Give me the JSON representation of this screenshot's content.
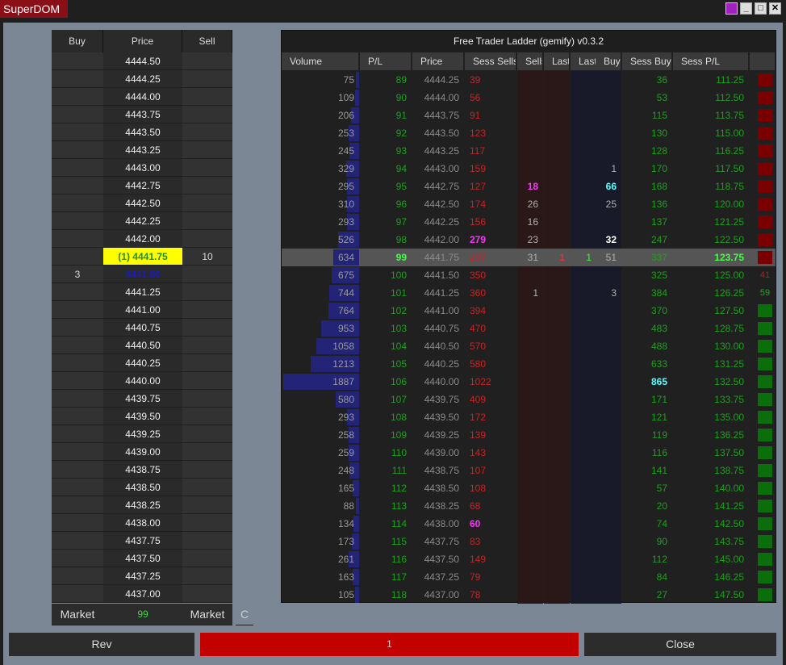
{
  "window": {
    "title": "SuperDOM"
  },
  "dom": {
    "headers": {
      "buy": "Buy",
      "price": "Price",
      "sell": "Sell"
    },
    "rows": [
      {
        "price": "4444.50",
        "buy": "",
        "sell": ""
      },
      {
        "price": "4444.25",
        "buy": "",
        "sell": ""
      },
      {
        "price": "4444.00",
        "buy": "",
        "sell": ""
      },
      {
        "price": "4443.75",
        "buy": "",
        "sell": ""
      },
      {
        "price": "4443.50",
        "buy": "",
        "sell": ""
      },
      {
        "price": "4443.25",
        "buy": "",
        "sell": ""
      },
      {
        "price": "4443.00",
        "buy": "",
        "sell": ""
      },
      {
        "price": "4442.75",
        "buy": "",
        "sell": ""
      },
      {
        "price": "4442.50",
        "buy": "",
        "sell": ""
      },
      {
        "price": "4442.25",
        "buy": "",
        "sell": ""
      },
      {
        "price": "4442.00",
        "buy": "",
        "sell": ""
      },
      {
        "price": "(1) 4441.75",
        "buy": "",
        "sell": "10",
        "style": "position"
      },
      {
        "price": "4441.50",
        "buy": "3",
        "sell": "",
        "style": "bid"
      },
      {
        "price": "4441.25",
        "buy": "",
        "sell": ""
      },
      {
        "price": "4441.00",
        "buy": "",
        "sell": ""
      },
      {
        "price": "4440.75",
        "buy": "",
        "sell": ""
      },
      {
        "price": "4440.50",
        "buy": "",
        "sell": ""
      },
      {
        "price": "4440.25",
        "buy": "",
        "sell": ""
      },
      {
        "price": "4440.00",
        "buy": "",
        "sell": ""
      },
      {
        "price": "4439.75",
        "buy": "",
        "sell": ""
      },
      {
        "price": "4439.50",
        "buy": "",
        "sell": ""
      },
      {
        "price": "4439.25",
        "buy": "",
        "sell": ""
      },
      {
        "price": "4439.00",
        "buy": "",
        "sell": ""
      },
      {
        "price": "4438.75",
        "buy": "",
        "sell": ""
      },
      {
        "price": "4438.50",
        "buy": "",
        "sell": ""
      },
      {
        "price": "4438.25",
        "buy": "",
        "sell": ""
      },
      {
        "price": "4438.00",
        "buy": "",
        "sell": ""
      },
      {
        "price": "4437.75",
        "buy": "",
        "sell": ""
      },
      {
        "price": "4437.50",
        "buy": "",
        "sell": ""
      },
      {
        "price": "4437.25",
        "buy": "",
        "sell": ""
      },
      {
        "price": "4437.00",
        "buy": "",
        "sell": ""
      }
    ],
    "footer": {
      "buy_market": "Market",
      "qty": "99",
      "sell_market": "Market",
      "extra": "C"
    }
  },
  "ladder": {
    "title": "Free Trader Ladder (gemify) v0.3.2",
    "headers": [
      "Volume",
      "P/L",
      "Price",
      "Sess Sells",
      "Sells",
      "Last",
      "Last",
      "Buys",
      "Sess Buys",
      "Sess P/L",
      ""
    ],
    "max_volume": 1887,
    "rows": [
      {
        "volume": "75",
        "pl": "89",
        "price": "4444.25",
        "sess_sells": "39",
        "sells": "",
        "last_s": "",
        "last_b": "",
        "buys": "",
        "sess_buys": "36",
        "sess_pl": "111.25",
        "sig": "red"
      },
      {
        "volume": "109",
        "pl": "90",
        "price": "4444.00",
        "sess_sells": "56",
        "sells": "",
        "last_s": "",
        "last_b": "",
        "buys": "",
        "sess_buys": "53",
        "sess_pl": "112.50",
        "sig": "red"
      },
      {
        "volume": "206",
        "pl": "91",
        "price": "4443.75",
        "sess_sells": "91",
        "sells": "",
        "last_s": "",
        "last_b": "",
        "buys": "",
        "sess_buys": "115",
        "sess_pl": "113.75",
        "sig": "red"
      },
      {
        "volume": "253",
        "pl": "92",
        "price": "4443.50",
        "sess_sells": "123",
        "sells": "",
        "last_s": "",
        "last_b": "",
        "buys": "",
        "sess_buys": "130",
        "sess_pl": "115.00",
        "sig": "red"
      },
      {
        "volume": "245",
        "pl": "93",
        "price": "4443.25",
        "sess_sells": "117",
        "sells": "",
        "last_s": "",
        "last_b": "",
        "buys": "",
        "sess_buys": "128",
        "sess_pl": "116.25",
        "sig": "red"
      },
      {
        "volume": "329",
        "pl": "94",
        "price": "4443.00",
        "sess_sells": "159",
        "sells": "",
        "last_s": "",
        "last_b": "",
        "buys": "1",
        "sess_buys": "170",
        "sess_pl": "117.50",
        "sig": "red"
      },
      {
        "volume": "295",
        "pl": "95",
        "price": "4442.75",
        "sess_sells": "127",
        "sells": "18",
        "sells_style": "magenta",
        "last_s": "",
        "last_b": "",
        "buys": "66",
        "buys_style": "cyan",
        "sess_buys": "168",
        "sess_pl": "118.75",
        "sig": "red"
      },
      {
        "volume": "310",
        "pl": "96",
        "price": "4442.50",
        "sess_sells": "174",
        "sells": "26",
        "last_s": "",
        "last_b": "",
        "buys": "25",
        "sess_buys": "136",
        "sess_pl": "120.00",
        "sig": "red"
      },
      {
        "volume": "293",
        "pl": "97",
        "price": "4442.25",
        "sess_sells": "156",
        "sells": "16",
        "last_s": "",
        "last_b": "",
        "buys": "",
        "sess_buys": "137",
        "sess_pl": "121.25",
        "sig": "red"
      },
      {
        "volume": "526",
        "pl": "98",
        "price": "4442.00",
        "sess_sells": "279",
        "sess_sells_style": "magenta",
        "sells": "23",
        "last_s": "",
        "last_b": "",
        "buys": "32",
        "buys_style": "white",
        "sess_buys": "247",
        "sess_pl": "122.50",
        "sig": "red"
      },
      {
        "volume": "634",
        "pl": "99",
        "price": "4441.75",
        "sess_sells": "297",
        "sells": "31",
        "last_s": "1",
        "last_b": "1",
        "buys": "51",
        "sess_buys": "337",
        "sess_pl": "123.75",
        "sig": "red",
        "current": true
      },
      {
        "volume": "675",
        "pl": "100",
        "price": "4441.50",
        "sess_sells": "350",
        "sells": "",
        "last_s": "",
        "last_b": "",
        "buys": "",
        "sess_buys": "325",
        "sess_pl": "125.00",
        "sig": "red",
        "sig_text": "41"
      },
      {
        "volume": "744",
        "pl": "101",
        "price": "4441.25",
        "sess_sells": "360",
        "sells": "1",
        "last_s": "",
        "last_b": "",
        "buys": "3",
        "sess_buys": "384",
        "sess_pl": "126.25",
        "sig": "green",
        "sig_text": "59"
      },
      {
        "volume": "764",
        "pl": "102",
        "price": "4441.00",
        "sess_sells": "394",
        "sells": "",
        "last_s": "",
        "last_b": "",
        "buys": "",
        "sess_buys": "370",
        "sess_pl": "127.50",
        "sig": "green"
      },
      {
        "volume": "953",
        "pl": "103",
        "price": "4440.75",
        "sess_sells": "470",
        "sells": "",
        "last_s": "",
        "last_b": "",
        "buys": "",
        "sess_buys": "483",
        "sess_pl": "128.75",
        "sig": "green"
      },
      {
        "volume": "1058",
        "pl": "104",
        "price": "4440.50",
        "sess_sells": "570",
        "sells": "",
        "last_s": "",
        "last_b": "",
        "buys": "",
        "sess_buys": "488",
        "sess_pl": "130.00",
        "sig": "green"
      },
      {
        "volume": "1213",
        "pl": "105",
        "price": "4440.25",
        "sess_sells": "580",
        "sells": "",
        "last_s": "",
        "last_b": "",
        "buys": "",
        "sess_buys": "633",
        "sess_pl": "131.25",
        "sig": "green"
      },
      {
        "volume": "1887",
        "pl": "106",
        "price": "4440.00",
        "sess_sells": "1022",
        "sells": "",
        "last_s": "",
        "last_b": "",
        "buys": "",
        "sess_buys": "865",
        "sess_buys_style": "cyan",
        "sess_pl": "132.50",
        "sig": "green"
      },
      {
        "volume": "580",
        "pl": "107",
        "price": "4439.75",
        "sess_sells": "409",
        "sells": "",
        "last_s": "",
        "last_b": "",
        "buys": "",
        "sess_buys": "171",
        "sess_pl": "133.75",
        "sig": "green"
      },
      {
        "volume": "293",
        "pl": "108",
        "price": "4439.50",
        "sess_sells": "172",
        "sells": "",
        "last_s": "",
        "last_b": "",
        "buys": "",
        "sess_buys": "121",
        "sess_pl": "135.00",
        "sig": "green"
      },
      {
        "volume": "258",
        "pl": "109",
        "price": "4439.25",
        "sess_sells": "139",
        "sells": "",
        "last_s": "",
        "last_b": "",
        "buys": "",
        "sess_buys": "119",
        "sess_pl": "136.25",
        "sig": "green"
      },
      {
        "volume": "259",
        "pl": "110",
        "price": "4439.00",
        "sess_sells": "143",
        "sells": "",
        "last_s": "",
        "last_b": "",
        "buys": "",
        "sess_buys": "116",
        "sess_pl": "137.50",
        "sig": "green"
      },
      {
        "volume": "248",
        "pl": "111",
        "price": "4438.75",
        "sess_sells": "107",
        "sells": "",
        "last_s": "",
        "last_b": "",
        "buys": "",
        "sess_buys": "141",
        "sess_pl": "138.75",
        "sig": "green"
      },
      {
        "volume": "165",
        "pl": "112",
        "price": "4438.50",
        "sess_sells": "108",
        "sells": "",
        "last_s": "",
        "last_b": "",
        "buys": "",
        "sess_buys": "57",
        "sess_pl": "140.00",
        "sig": "green"
      },
      {
        "volume": "88",
        "pl": "113",
        "price": "4438.25",
        "sess_sells": "68",
        "sells": "",
        "last_s": "",
        "last_b": "",
        "buys": "",
        "sess_buys": "20",
        "sess_pl": "141.25",
        "sig": "green"
      },
      {
        "volume": "134",
        "pl": "114",
        "price": "4438.00",
        "sess_sells": "60",
        "sess_sells_style": "magenta",
        "sells": "",
        "last_s": "",
        "last_b": "",
        "buys": "",
        "sess_buys": "74",
        "sess_pl": "142.50",
        "sig": "green"
      },
      {
        "volume": "173",
        "pl": "115",
        "price": "4437.75",
        "sess_sells": "83",
        "sells": "",
        "last_s": "",
        "last_b": "",
        "buys": "",
        "sess_buys": "90",
        "sess_pl": "143.75",
        "sig": "green"
      },
      {
        "volume": "261",
        "pl": "116",
        "price": "4437.50",
        "sess_sells": "149",
        "sells": "",
        "last_s": "",
        "last_b": "",
        "buys": "",
        "sess_buys": "112",
        "sess_pl": "145.00",
        "sig": "green"
      },
      {
        "volume": "163",
        "pl": "117",
        "price": "4437.25",
        "sess_sells": "79",
        "sells": "",
        "last_s": "",
        "last_b": "",
        "buys": "",
        "sess_buys": "84",
        "sess_pl": "146.25",
        "sig": "green"
      },
      {
        "volume": "105",
        "pl": "118",
        "price": "4437.00",
        "sess_sells": "78",
        "sells": "",
        "last_s": "",
        "last_b": "",
        "buys": "",
        "sess_buys": "27",
        "sess_pl": "147.50",
        "sig": "green"
      }
    ]
  },
  "controls": {
    "rev": "Rev",
    "qty": "1",
    "close": "Close"
  },
  "colors": {
    "position": "#ffff00",
    "bid": "#1a1acc",
    "green": "#1f8f1f",
    "red": "#cc2222",
    "volume_bar": "#232378",
    "signal_red": "#7a0000",
    "signal_green": "#0a6e0a",
    "qty_bar": "#c20000",
    "magenta": "#ff33ff",
    "cyan": "#55ffff"
  }
}
